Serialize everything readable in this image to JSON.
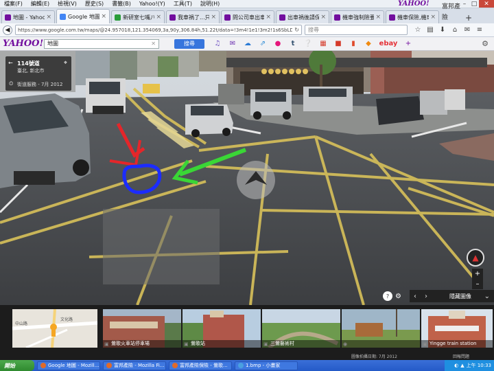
{
  "menubar": {
    "items": [
      "檔案(F)",
      "編輯(E)",
      "檢視(V)",
      "歷史(S)",
      "書籤(B)",
      "Yahoo!(Y)",
      "工具(T)",
      "說明(H)"
    ],
    "brand": "YAHOO!"
  },
  "tabs": [
    {
      "label": "地圖 - Yahoo奇...",
      "icon_color": "#720e9e",
      "active": false
    },
    {
      "label": "Google 地圖",
      "icon_color": "#4285f4",
      "active": true
    },
    {
      "label": "新研室七嘴八...",
      "icon_color": "#2a9d3a",
      "active": false
    },
    {
      "label": "我車禍了...只有...",
      "icon_color": "#720e9e",
      "active": false
    },
    {
      "label": "問公司車出車...",
      "icon_color": "#720e9e",
      "active": false
    },
    {
      "label": "出車禍後請保...",
      "icon_color": "#720e9e",
      "active": false
    },
    {
      "label": "機車強制險要...",
      "icon_color": "#720e9e",
      "active": false
    },
    {
      "label": "機車保險,機車強制...",
      "icon_color": "#720e9e",
      "active": false
    }
  ],
  "tabbar_more": "富邦產險",
  "navbar": {
    "url": "https://www.google.com.tw/maps/@24.957018,121.354069,3a,90y,306.84h,51.22t/data=!3m4!1e1!3m2!1s6SbLDS0zTM2cbX4TF7euA!2e0",
    "search_placeholder": "搜尋"
  },
  "yahoo_toolbar": {
    "logo": "YAHOO!",
    "query": "地圖",
    "search_button": "搜尋",
    "icons": [
      "bell-icon",
      "mail-icon",
      "weather-icon",
      "chart-icon",
      "flickr-icon",
      "tumblr-icon",
      "answers-icon",
      "calendar-icon",
      "news-icon",
      "bookmark-icon",
      "shopping-icon"
    ],
    "ebay": "ebay"
  },
  "location": {
    "title": "114號道",
    "subtitle": "臺北, 新北市",
    "date": "街道服務 - 7月 2012"
  },
  "controls": {
    "help": "?",
    "label": "隱藏圖像"
  },
  "thumbnails": [
    {
      "caption": "鶯歌火車站停車場"
    },
    {
      "caption": "鶯歌站"
    },
    {
      "caption": "三鶯藝術村"
    },
    {
      "caption": ""
    },
    {
      "caption": "Yingge train station"
    }
  ],
  "minimap": {
    "label1": "中山路",
    "label2": "文化路"
  },
  "footer": {
    "date": "圖像拍攝日期: 7月 2012",
    "report": "回報問題"
  },
  "taskbar": {
    "start": "開始",
    "items": [
      {
        "label": "Google 地圖 - Mozill..."
      },
      {
        "label": "富邦產險 - Mozilla Fi..."
      },
      {
        "label": "富邦產險保險 - 鶯歌..."
      },
      {
        "label": "1.bmp - 小畫家"
      }
    ],
    "time": "上午 10:33"
  }
}
